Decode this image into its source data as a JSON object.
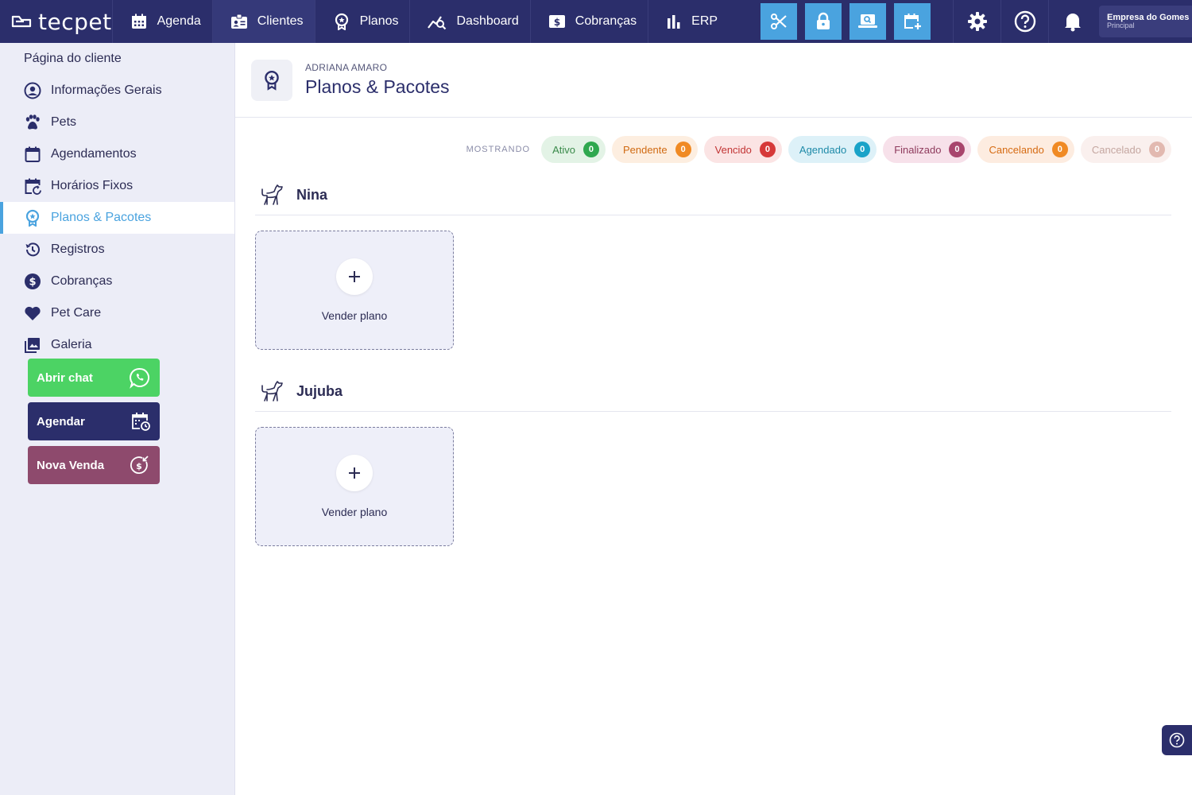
{
  "brand": {
    "name": "tecpet"
  },
  "nav": {
    "items": [
      {
        "label": "Agenda",
        "icon": "calendar-icon"
      },
      {
        "label": "Clientes",
        "icon": "client-card-icon"
      },
      {
        "label": "Planos",
        "icon": "badge-icon"
      },
      {
        "label": "Dashboard",
        "icon": "analytics-icon"
      },
      {
        "label": "Cobranças",
        "icon": "dollar-note-icon"
      },
      {
        "label": "ERP",
        "icon": "bar-chart-icon"
      }
    ],
    "active": "Clientes",
    "tools": [
      "scissors-icon",
      "lock-icon",
      "laptop-search-icon",
      "calendar-add-icon"
    ],
    "utility_icons": [
      "gear-icon",
      "help-icon",
      "bell-icon"
    ]
  },
  "company": {
    "name": "Empresa do Gomes",
    "unit": "Principal"
  },
  "sidebar": {
    "title": "Página do cliente",
    "items": [
      {
        "label": "Informações Gerais",
        "icon": "user-circle-icon"
      },
      {
        "label": "Pets",
        "icon": "paw-icon"
      },
      {
        "label": "Agendamentos",
        "icon": "calendar-icon"
      },
      {
        "label": "Horários Fixos",
        "icon": "calendar-repeat-icon"
      },
      {
        "label": "Planos & Pacotes",
        "icon": "badge-icon"
      },
      {
        "label": "Registros",
        "icon": "history-icon"
      },
      {
        "label": "Cobranças",
        "icon": "dollar-circle-icon"
      },
      {
        "label": "Pet Care",
        "icon": "heart-icon"
      },
      {
        "label": "Galeria",
        "icon": "gallery-icon"
      }
    ],
    "active": "Planos & Pacotes",
    "actions": {
      "chat": "Abrir chat",
      "agendar": "Agendar",
      "venda": "Nova Venda"
    }
  },
  "header": {
    "client_name": "ADRIANA AMARO",
    "title": "Planos & Pacotes"
  },
  "filters": {
    "label": "MOSTRANDO",
    "chips": [
      {
        "label": "Ativo",
        "count": "0",
        "color": "#2fa84f"
      },
      {
        "label": "Pendente",
        "count": "0",
        "color": "#f08a24"
      },
      {
        "label": "Vencido",
        "count": "0",
        "color": "#d63838"
      },
      {
        "label": "Agendado",
        "count": "0",
        "color": "#1aa3c8"
      },
      {
        "label": "Finalizado",
        "count": "0",
        "color": "#a8456d"
      },
      {
        "label": "Cancelando",
        "count": "0",
        "color": "#f08a24"
      },
      {
        "label": "Cancelado",
        "count": "0",
        "color": "#e2b9b0"
      }
    ]
  },
  "pets": [
    {
      "name": "Nina",
      "sell_label": "Vender plano"
    },
    {
      "name": "Jujuba",
      "sell_label": "Vender plano"
    }
  ],
  "colors": {
    "primary": "#2b2e6b",
    "accent": "#4aa3df",
    "whatsapp": "#4cd364",
    "sale": "#8e4a6d"
  }
}
